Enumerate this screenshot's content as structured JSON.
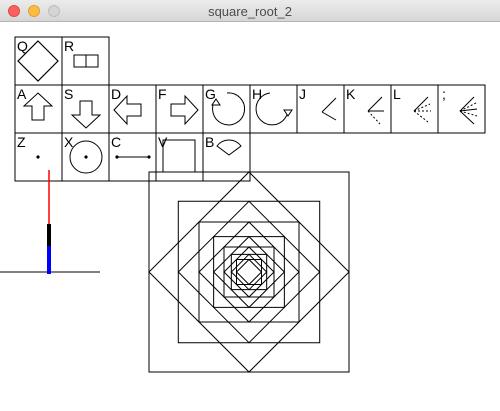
{
  "window": {
    "title": "square_root_2"
  },
  "palette": {
    "rows": [
      [
        {
          "key": "Q",
          "icon": "diamond-icon"
        },
        {
          "key": "R",
          "icon": "split-rectangle-icon"
        }
      ],
      [
        {
          "key": "A",
          "icon": "arrow-up-icon"
        },
        {
          "key": "S",
          "icon": "arrow-down-icon"
        },
        {
          "key": "D",
          "icon": "arrow-left-icon"
        },
        {
          "key": "F",
          "icon": "arrow-right-icon"
        },
        {
          "key": "G",
          "icon": "rotate-ccw-icon"
        },
        {
          "key": "H",
          "icon": "rotate-cw-icon"
        },
        {
          "key": "J",
          "icon": "angle-two-rays-icon"
        },
        {
          "key": "K",
          "icon": "angle-dashed-icon"
        },
        {
          "key": "L",
          "icon": "angle-fan-icon"
        },
        {
          "key": ";",
          "icon": "angle-fan-wide-icon"
        }
      ],
      [
        {
          "key": "Z",
          "icon": "dot-icon"
        },
        {
          "key": "X",
          "icon": "circle-center-icon"
        },
        {
          "key": "C",
          "icon": "segment-icon"
        },
        {
          "key": "V",
          "icon": "square-icon"
        },
        {
          "key": "B",
          "icon": "sector-icon"
        }
      ]
    ]
  },
  "colors": {
    "turtle_head": "#ff0000",
    "turtle_neck": "#000000",
    "turtle_body": "#0000ff"
  },
  "drawing": {
    "shape": "nested squares rotated 45° alternately",
    "square_count": 14
  }
}
